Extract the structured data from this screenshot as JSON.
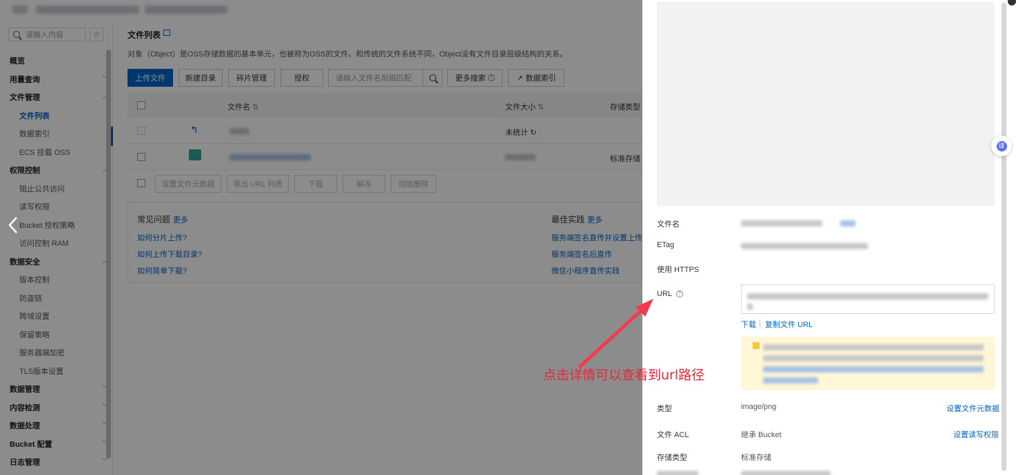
{
  "sidebar": {
    "search_placeholder": "请输入内容",
    "star": "☆",
    "items": [
      {
        "label": "概览",
        "type": "group",
        "chevron": ""
      },
      {
        "label": "用量查询",
        "type": "group",
        "chevron": "﹀"
      },
      {
        "label": "文件管理",
        "type": "group",
        "chevron": "︿"
      },
      {
        "label": "文件列表",
        "type": "active",
        "chevron": ""
      },
      {
        "label": "数据索引",
        "type": "sub",
        "chevron": ""
      },
      {
        "label": "ECS 挂载 OSS",
        "type": "sub",
        "chevron": ""
      },
      {
        "label": "权限控制",
        "type": "group",
        "chevron": "︿"
      },
      {
        "label": "阻止公共访问",
        "type": "sub",
        "chevron": ""
      },
      {
        "label": "读写权限",
        "type": "sub",
        "chevron": ""
      },
      {
        "label": "Bucket 授权策略",
        "type": "sub",
        "chevron": ""
      },
      {
        "label": "访问控制 RAM",
        "type": "sub",
        "chevron": ""
      },
      {
        "label": "数据安全",
        "type": "group",
        "chevron": "︿"
      },
      {
        "label": "版本控制",
        "type": "sub",
        "chevron": ""
      },
      {
        "label": "防盗链",
        "type": "sub",
        "chevron": ""
      },
      {
        "label": "跨域设置",
        "type": "sub",
        "chevron": ""
      },
      {
        "label": "保留策略",
        "type": "sub",
        "chevron": ""
      },
      {
        "label": "服务器端加密",
        "type": "sub",
        "chevron": ""
      },
      {
        "label": "TLS版本设置",
        "type": "sub",
        "chevron": ""
      },
      {
        "label": "数据管理",
        "type": "group",
        "chevron": "﹀"
      },
      {
        "label": "内容检测",
        "type": "group",
        "chevron": "﹀"
      },
      {
        "label": "数据处理",
        "type": "group",
        "chevron": "﹀"
      },
      {
        "label": "Bucket 配置",
        "type": "group",
        "chevron": "﹀"
      },
      {
        "label": "日志管理",
        "type": "group",
        "chevron": "﹀"
      }
    ]
  },
  "main": {
    "title": "文件列表",
    "description": "对象（Object）是OSS存储数据的基本单元，也被称为OSS的文件。和传统的文件系统不同，Object没有文件目录层级结构的关系。",
    "toolbar": {
      "upload": "上传文件",
      "new_dir": "新建目录",
      "fragments": "碎片管理",
      "authorize": "授权",
      "search_placeholder": "请输入文件名前缀匹配",
      "more_search": "更多搜索",
      "data_index": "数据索引"
    },
    "table": {
      "col_name": "文件名",
      "col_size": "文件大小",
      "col_storage": "存储类型",
      "sort_icon": "⇅",
      "back_row": {
        "icon": "↰",
        "size": "未统计",
        "refresh_icon": "↻"
      },
      "file_row": {
        "storage": "标准存储"
      }
    },
    "bulk": {
      "set_meta": "设置文件元数据",
      "export_url": "导出 URL 列表",
      "download": "下载",
      "unfreeze": "解冻",
      "delete": "彻底删除"
    },
    "faq": {
      "title": "常见问题",
      "more": "更多",
      "links": [
        "如何分片上传?",
        "如何上传下载目录?",
        "如何简单下载?"
      ]
    },
    "best": {
      "title": "最佳实践",
      "more": "更多",
      "links": [
        "服务端签名直传并设置上传回调",
        "服务端签名后直传",
        "微信小程序直传实践"
      ]
    }
  },
  "drawer": {
    "label_filename": "文件名",
    "label_etag": "ETag",
    "label_https": "使用 HTTPS",
    "https_enabled": true,
    "label_url": "URL",
    "help_glyph": "?",
    "link_download": "下载",
    "link_separator": "|",
    "link_copy_url": "复制文件 URL",
    "label_type": "类型",
    "value_type": "image/png",
    "link_set_meta": "设置文件元数据",
    "label_acl": "文件 ACL",
    "value_acl": "继承 Bucket",
    "link_set_acl": "设置读写权限",
    "label_storage": "存储类型",
    "value_storage": "标准存储",
    "float_button": "译"
  },
  "annotation": {
    "text": "点击详情可以查看到url路径",
    "color": "#e0293a"
  },
  "colors": {
    "accent": "#0064c8",
    "toggle_on": "#1e9a1e",
    "overlay": "rgba(0,0,0,0.45)"
  }
}
